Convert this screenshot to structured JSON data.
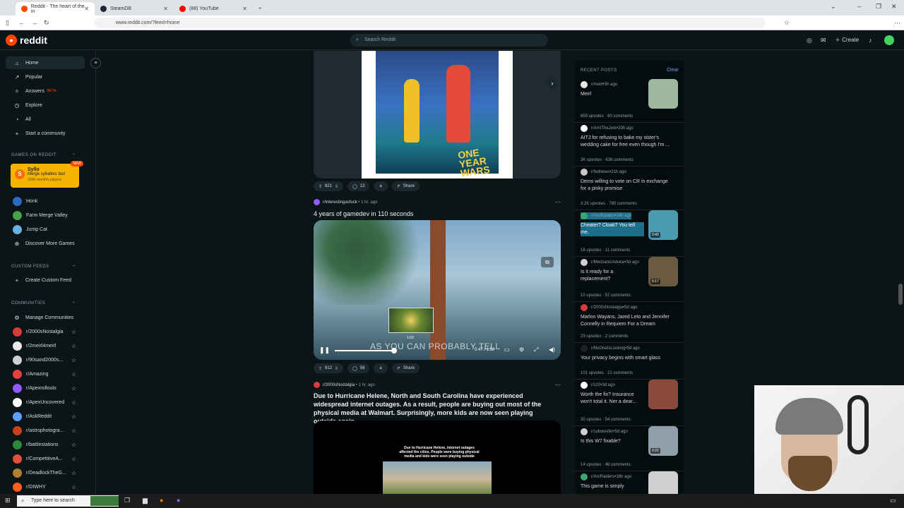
{
  "browser": {
    "tabs": [
      {
        "label": "Reddit - The heart of the in",
        "color": "#ff4500"
      },
      {
        "label": "SteamDB",
        "color": "#1b2838"
      },
      {
        "label": "(88) YouTube",
        "color": "#ff0000"
      }
    ],
    "url": "www.reddit.com/?feed=home"
  },
  "topbar": {
    "logo": "reddit",
    "search_placeholder": "Search Reddit",
    "create_label": "Create"
  },
  "sidebar": {
    "main": [
      {
        "label": "Home",
        "icon": "home-icon"
      },
      {
        "label": "Popular",
        "icon": "popular-icon"
      },
      {
        "label": "Answers",
        "icon": "answers-icon",
        "badge": "BETA"
      },
      {
        "label": "Explore",
        "icon": "explore-icon"
      },
      {
        "label": "All",
        "icon": "all-icon"
      },
      {
        "label": "Start a community",
        "icon": "plus-icon"
      }
    ],
    "games_head": "GAMES ON REDDIT",
    "syllo": {
      "name": "Syllo",
      "desc": "Merge syllables fast",
      "players": "334K monthly players",
      "new": "NEW"
    },
    "games": [
      "Honk",
      "Farm Merge Valley",
      "Jump Cat",
      "Discover More Games"
    ],
    "custom_head": "CUSTOM FEEDS",
    "create_feed": "Create Custom Feed",
    "communities_head": "COMMUNITIES",
    "manage": "Manage Communities",
    "communities": [
      {
        "name": "r/2000sNostalgia",
        "color": "#d93a3a"
      },
      {
        "name": "r/2meirl4meirl",
        "color": "#e8e8e8"
      },
      {
        "name": "r/90sand2000s...",
        "color": "#cfcfcf"
      },
      {
        "name": "r/Amazing",
        "color": "#e84040"
      },
      {
        "name": "r/Apexrollouts",
        "color": "#8c5cff"
      },
      {
        "name": "r/ApexUncovered",
        "color": "#ffffff"
      },
      {
        "name": "r/AskReddit",
        "color": "#5ea0ff"
      },
      {
        "name": "r/astrophotogra...",
        "color": "#c84020"
      },
      {
        "name": "r/battlestations",
        "color": "#2a8a3a"
      },
      {
        "name": "r/CompetitiveA...",
        "color": "#e0503a"
      },
      {
        "name": "r/DeadlockTheG...",
        "color": "#b08030"
      },
      {
        "name": "r/DIWHY",
        "color": "#ff6020"
      }
    ]
  },
  "feed": {
    "post1": {
      "upvotes": "821",
      "comments": "13",
      "share": "Share",
      "poster_title": "ONE YEAR WARS"
    },
    "post2": {
      "sub": "r/interestingasfuck",
      "age": "1 hr. ago",
      "title": "4 years of gamedev in 110 seconds",
      "caption": "AS YOU CAN PROBABLY TELL",
      "preview_time": "1:03",
      "time": "0:47 / 1:50",
      "upvotes": "812",
      "comments": "58",
      "share": "Share"
    },
    "post3": {
      "sub": "r/2000sNostalgia",
      "age": "1 hr. ago",
      "title": "Due to Hurricane Helene, North and South Carolina have experienced widespread internet outages. As a result, people are buying out most of the physical media at Walmart. Surprisingly, more kids are now seen playing outside again.",
      "image_caption": "Due to Hurricane Helene, internet outages affected the cities. People were buying physical media and kids were seen playing outside"
    }
  },
  "recent": {
    "head": "RECENT POSTS",
    "clear": "Clear",
    "items": [
      {
        "sub": "r/meirl",
        "age": "3h ago",
        "title": "Meirl",
        "stats": "859 upvotes · 60 comments",
        "thumb": "#9fb8a0",
        "av": "#e8e8e8"
      },
      {
        "sub": "r/AmITheJerk",
        "age": "23h ago",
        "title": "AITJ for refusing to bake my sister's wedding cake for free even though I'm ...",
        "stats": "3K upvotes · 636 comments",
        "thumb": null,
        "av": "#ffffff"
      },
      {
        "sub": "r/fednews",
        "age": "21h ago",
        "title": "Dems willing to vote on CR in exchange for a pinky promise",
        "stats": "3.2K upvotes · 780 comments",
        "thumb": null,
        "av": "#c8c8c8"
      },
      {
        "sub": "r/ArcRaiders",
        "age": "14h ago",
        "title": "Cheater? Cloak? You tell me.",
        "stats": "18 upvotes · 11 comments",
        "thumb": "#4a9ab0",
        "av": "#3aa870",
        "highlight": true,
        "badge": "0:40"
      },
      {
        "sub": "r/MechanicAdvice",
        "age": "3d ago",
        "title": "Is it ready for a replacement?",
        "stats": "10 upvotes · 57 comments",
        "thumb": "#6a5a40",
        "av": "#cfcfcf",
        "badge": "0:17"
      },
      {
        "sub": "r/2000sNostalgia",
        "age": "5d ago",
        "title": "Marlon Wayans, Jared Leto and Jennifer Connelly in Requiem For a Dream",
        "stats": "23 upvotes · 2 comments",
        "thumb": null,
        "av": "#d93a3a"
      },
      {
        "sub": "r/NoOneIsLooking",
        "age": "5d ago",
        "title": "Your privacy begins with smart glass",
        "stats": "101 upvotes · 21 comments",
        "thumb": null,
        "av": "#222222"
      },
      {
        "sub": "r/s10",
        "age": "3d ago",
        "title": "Worth the fix? Insurance won't total it. Ner a dear...",
        "stats": "30 upvotes · 54 comments",
        "thumb": "#8a4a3a",
        "av": "#ffffff"
      },
      {
        "sub": "r/subwoofer",
        "age": "5d ago",
        "title": "Is this W7 fixable?",
        "stats": "14 upvotes · 48 comments",
        "thumb": "#8fa0a8",
        "av": "#cfcfcf",
        "badge": "0:20"
      },
      {
        "sub": "r/ArcRaiders",
        "age": "16h ago",
        "title": "This game is simply",
        "stats": "",
        "thumb": "#d0d0d0",
        "av": "#3aa870"
      }
    ]
  },
  "taskbar": {
    "search": "Type here to search"
  }
}
